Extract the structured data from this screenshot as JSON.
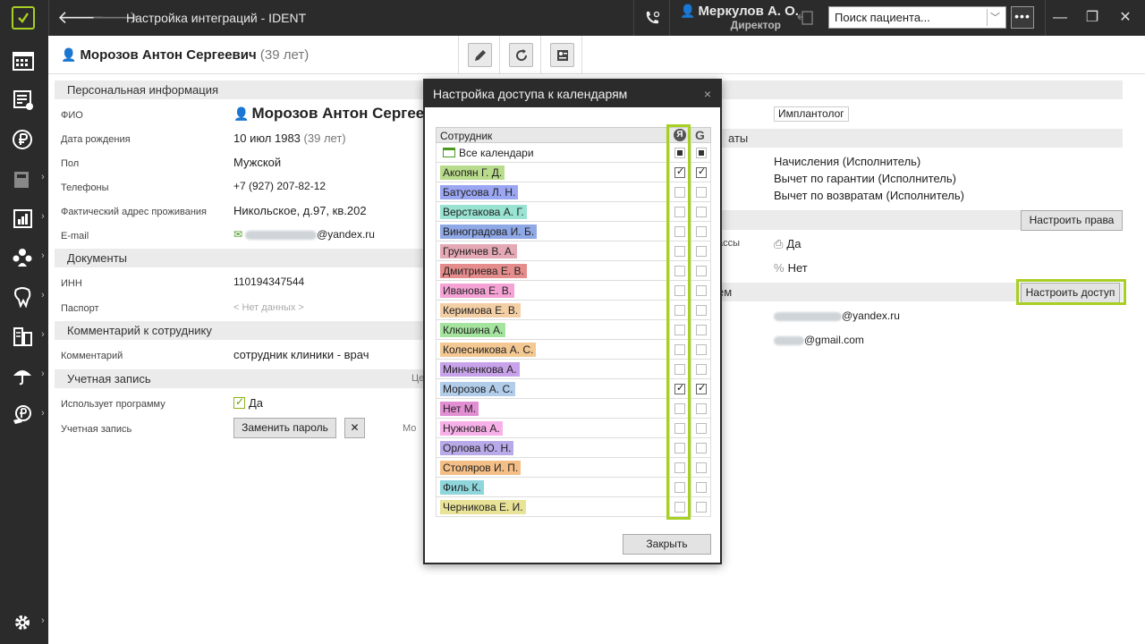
{
  "titlebar": {
    "title": "Настройка интеграций - IDENT",
    "user_name": "Меркулов А. О.",
    "user_role": "Директор",
    "search_placeholder": "Поиск пациента...",
    "more_label": "•••",
    "min_label": "—",
    "max_label": "❐",
    "close_label": "✕"
  },
  "sidebar": {
    "items": [
      {
        "icon": "calendar-icon"
      },
      {
        "icon": "tasks-icon"
      },
      {
        "icon": "ruble-icon"
      },
      {
        "icon": "cash-register-icon"
      },
      {
        "icon": "reports-icon"
      },
      {
        "icon": "users-icon"
      },
      {
        "icon": "tooth-icon"
      },
      {
        "icon": "lab-icon"
      },
      {
        "icon": "insurance-icon"
      },
      {
        "icon": "ruble-hand-icon"
      }
    ],
    "settings_icon": "gear-icon"
  },
  "header": {
    "person_name": "Морозов Антон Сергеевич",
    "person_age": "(39 лет)"
  },
  "sections": {
    "personal": "Персональная информация",
    "documents": "Документы",
    "comment": "Комментарий к сотруднику",
    "account": "Учетная запись"
  },
  "fields": {
    "fio_label": "ФИО",
    "fio_value": "Морозов Антон Сергеевич",
    "birth_label": "Дата рождения",
    "birth_value": "10 июл 1983",
    "birth_age": "(39 лет)",
    "gender_label": "Пол",
    "gender_value": "Мужской",
    "phones_label": "Телефоны",
    "phones_value": "+7 (927) 207-82-12",
    "address_label": "Фактический адрес проживания",
    "address_value": "Никольское, д.97, кв.202",
    "email_label": "E-mail",
    "email_domain": "@yandex.ru",
    "inn_label": "ИНН",
    "inn_value": "110194347544",
    "passport_label": "Паспорт",
    "passport_value": "< Нет данных >",
    "comment_label": "Комментарий",
    "comment_value": "сотрудник клиники - врач",
    "uses_program_label": "Использует программу",
    "uses_program_value": "Да",
    "account_label": "Учетная запись",
    "change_password": "Заменить пароль",
    "clear_icon_label": "✕",
    "col_hint_1": "Це",
    "col_hint_2": "Мо"
  },
  "right_panel": {
    "specialty": "Имплантолог",
    "salary_header_tail": "аты",
    "salary_items": [
      "Начисления (Исполнитель)",
      "Вычет по гарантии (Исполнитель)",
      "Вычет по возвратам (Исполнитель)"
    ],
    "setup_rights": "Настроить права",
    "cash_label_tail": "ассы",
    "cash_value_1": "Да",
    "cash_value_2": "Нет",
    "calendar_header_tail": "ем",
    "setup_access": "Настроить доступ",
    "email_1_domain": "@yandex.ru",
    "email_2_domain": "@gmail.com"
  },
  "modal": {
    "title": "Настройка доступа к календарям",
    "close": "×",
    "col_employee": "Сотрудник",
    "col_yandex": "Я",
    "col_google": "G",
    "all_calendars": "Все календари",
    "close_button": "Закрыть",
    "rows": [
      {
        "name": "Акопян Г. Д.",
        "color": "#b9dc8c",
        "y": true,
        "g": true
      },
      {
        "name": "Батусова Л. Н.",
        "color": "#9aa6f2",
        "y": false,
        "g": false
      },
      {
        "name": "Верстакова А. Г.",
        "color": "#98e3d2",
        "y": false,
        "g": false
      },
      {
        "name": "Виноградова И. Б.",
        "color": "#8fa8e6",
        "y": false,
        "g": false
      },
      {
        "name": "Груничев В. А.",
        "color": "#e5a9b6",
        "y": false,
        "g": false
      },
      {
        "name": "Дмитриева Е. В.",
        "color": "#e58d8d",
        "y": false,
        "g": false
      },
      {
        "name": "Иванова Е. В.",
        "color": "#f5a3d5",
        "y": false,
        "g": false
      },
      {
        "name": "Керимова Е. В.",
        "color": "#f3cfa6",
        "y": false,
        "g": false
      },
      {
        "name": "Клюшина А.",
        "color": "#a5e49e",
        "y": false,
        "g": false
      },
      {
        "name": "Колесникова А. С.",
        "color": "#f3c893",
        "y": false,
        "g": false
      },
      {
        "name": "Минченкова А.",
        "color": "#c8a2ea",
        "y": false,
        "g": false
      },
      {
        "name": "Морозов А. С.",
        "color": "#b2cdea",
        "y": true,
        "g": true
      },
      {
        "name": "Нет М.",
        "color": "#e28ed2",
        "y": false,
        "g": false
      },
      {
        "name": "Нужнова А.",
        "color": "#f7b0e8",
        "y": false,
        "g": false
      },
      {
        "name": "Орлова Ю. Н.",
        "color": "#b8a9e8",
        "y": false,
        "g": false
      },
      {
        "name": "Столяров И. П.",
        "color": "#f4bf86",
        "y": false,
        "g": false
      },
      {
        "name": "Филь К.",
        "color": "#8fd6dc",
        "y": false,
        "g": false
      },
      {
        "name": "Черникова Е. И.",
        "color": "#e8e397",
        "y": false,
        "g": false
      }
    ]
  },
  "colors": {
    "accent": "#a8cf23",
    "dark": "#2b2b2b"
  }
}
